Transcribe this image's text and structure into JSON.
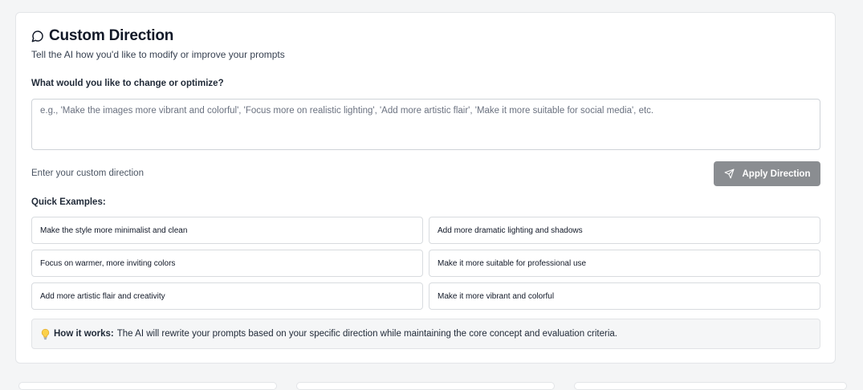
{
  "panel": {
    "title": "Custom Direction",
    "title_icon": "message-circle-icon",
    "subtitle": "Tell the AI how you'd like to modify or improve your prompts"
  },
  "form": {
    "label": "What would you like to change or optimize?",
    "value": "",
    "placeholder": "e.g., 'Make the images more vibrant and colorful', 'Focus more on realistic lighting', 'Add more artistic flair', 'Make it more suitable for social media', etc.",
    "helper": "Enter your custom direction",
    "apply_label": "Apply Direction",
    "apply_icon": "send-icon",
    "apply_color": "#8a8d91"
  },
  "quick_examples": {
    "label": "Quick Examples:",
    "items": [
      "Make the style more minimalist and clean",
      "Add more dramatic lighting and shadows",
      "Focus on warmer, more inviting colors",
      "Make it more suitable for professional use",
      "Add more artistic flair and creativity",
      "Make it more vibrant and colorful"
    ]
  },
  "how_it_works": {
    "icon": "lightbulb-icon",
    "heading": "How it works:",
    "text": "The AI will rewrite your prompts based on your specific direction while maintaining the core concept and evaluation criteria."
  }
}
